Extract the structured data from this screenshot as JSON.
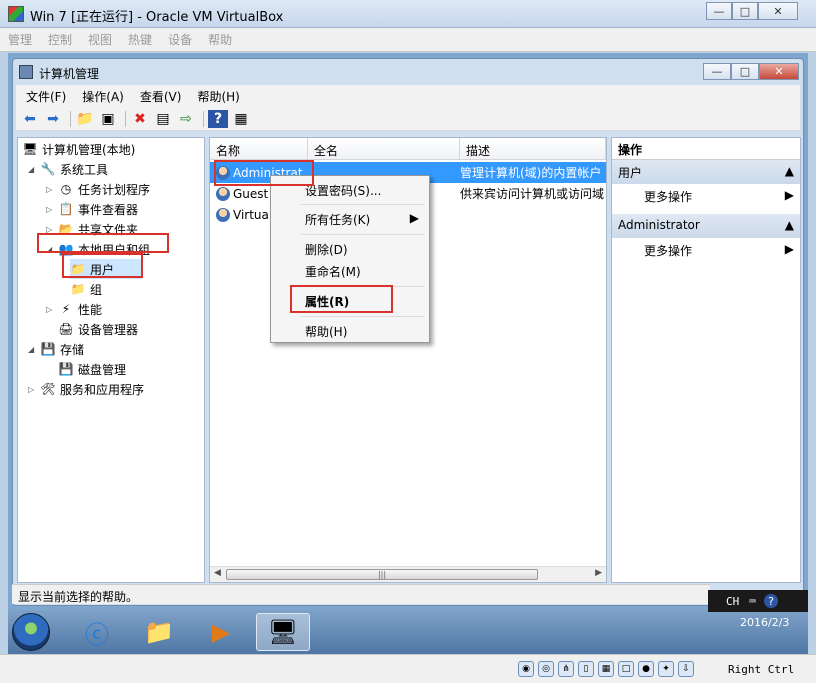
{
  "vbox": {
    "title": "Win 7 [正在运行] - Oracle VM VirtualBox",
    "menu": [
      "管理",
      "控制",
      "视图",
      "热键",
      "设备",
      "帮助"
    ],
    "host_key": "Right Ctrl"
  },
  "mmc": {
    "title": "计算机管理",
    "menu": [
      "文件(F)",
      "操作(A)",
      "查看(V)",
      "帮助(H)"
    ],
    "status": "显示当前选择的帮助。"
  },
  "tree": {
    "root": "计算机管理(本地)",
    "system_tools": "系统工具",
    "task_scheduler": "任务计划程序",
    "event_viewer": "事件查看器",
    "shared_folders": "共享文件夹",
    "local_users": "本地用户和组",
    "users": "用户",
    "groups": "组",
    "performance": "性能",
    "device_manager": "设备管理器",
    "storage": "存储",
    "disk_management": "磁盘管理",
    "services": "服务和应用程序"
  },
  "list": {
    "columns": [
      "名称",
      "全名",
      "描述"
    ],
    "rows": [
      {
        "name": "Administrat",
        "full": "",
        "desc": "管理计算机(域)的内置帐户"
      },
      {
        "name": "Guest",
        "full": "",
        "desc": "供来宾访问计算机或访问域"
      },
      {
        "name": "Virtual",
        "full": "",
        "desc": ""
      }
    ]
  },
  "actions": {
    "header": "操作",
    "group1": "用户",
    "more1": "更多操作",
    "group2": "Administrator",
    "more2": "更多操作"
  },
  "context_menu": {
    "set_password": "设置密码(S)...",
    "all_tasks": "所有任务(K)",
    "delete": "删除(D)",
    "rename": "重命名(M)",
    "properties": "属性(R)",
    "help": "帮助(H)"
  },
  "tray": {
    "lang": "CH",
    "date": "2016/2/3"
  }
}
